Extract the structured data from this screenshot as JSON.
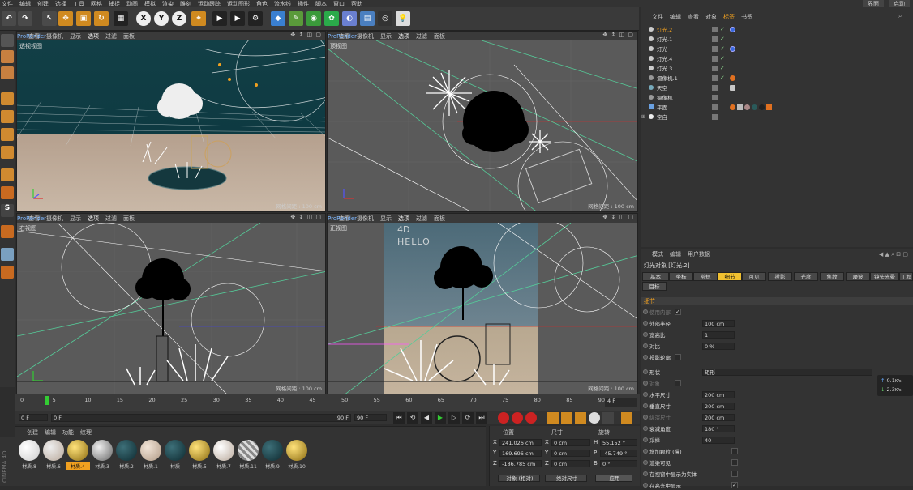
{
  "menubar": {
    "items": [
      "文件",
      "编辑",
      "创建",
      "选择",
      "工具",
      "网格",
      "捕捉",
      "动画",
      "模拟",
      "渲染",
      "雕刻",
      "运动跟踪",
      "运动图形",
      "角色",
      "流水线",
      "插件",
      "脚本",
      "窗口",
      "帮助"
    ],
    "right": [
      "界面",
      "启动"
    ]
  },
  "toolbar": {
    "x": "X",
    "y": "Y",
    "z": "Z"
  },
  "viewports": [
    {
      "menu": [
        "查看",
        "摄像机",
        "显示",
        "选项",
        "过滤",
        "面板",
        "ProRender"
      ],
      "title": "透视视图",
      "grid": "网格间距 : 100 cm"
    },
    {
      "menu": [
        "查看",
        "摄像机",
        "显示",
        "选项",
        "过滤",
        "面板",
        "ProRender"
      ],
      "title": "顶视图",
      "grid": "网格间距 : 100 cm"
    },
    {
      "menu": [
        "查看",
        "摄像机",
        "显示",
        "选项",
        "过滤",
        "面板",
        "ProRender"
      ],
      "title": "右视图",
      "grid": "网格间距 : 100 cm"
    },
    {
      "menu": [
        "查看",
        "摄像机",
        "显示",
        "选项",
        "过滤",
        "面板",
        "ProRender"
      ],
      "title": "正视图",
      "grid": "网格间距 : 100 cm"
    }
  ],
  "viewport_text": {
    "hello": "HELLO",
    "c4d": "4D"
  },
  "objmgr": {
    "menu": [
      "文件",
      "编辑",
      "查看",
      "对象",
      "标签",
      "书签"
    ],
    "rows": [
      "灯光.2",
      "灯光.1",
      "灯光",
      "灯光.4",
      "灯光.3",
      "摄像机.1",
      "天空",
      "摄像机",
      "平面",
      "空白"
    ]
  },
  "attr": {
    "menu": [
      "模式",
      "编辑",
      "用户数据"
    ],
    "title": "灯光对象 [灯光.2]",
    "tabs": [
      "基本",
      "坐标",
      "常规",
      "细节",
      "可见",
      "投影",
      "光度",
      "焦散",
      "噪波",
      "镜头光晕",
      "工程",
      "目标"
    ],
    "section": "细节",
    "props": [
      {
        "label": "使用内部",
        "value": "✓",
        "dim": true
      },
      {
        "label": "外部半径",
        "value": "100 cm"
      },
      {
        "label": "宽高比",
        "value": "1"
      },
      {
        "label": "对比",
        "value": "0 %"
      },
      {
        "label": "投影轮廓",
        "value": ""
      },
      {
        "label": "形状",
        "value": "矩形"
      },
      {
        "label": "对象",
        "value": "",
        "dim": true
      },
      {
        "label": "水平尺寸",
        "value": "200 cm"
      },
      {
        "label": "垂直尺寸",
        "value": "200 cm"
      },
      {
        "label": "纵深尺寸",
        "value": "200 cm",
        "dim": true
      },
      {
        "label": "衰减角度",
        "value": "180 °"
      },
      {
        "label": "采样",
        "value": "40"
      },
      {
        "label": "增加颗粒 (慢)",
        "value": ""
      },
      {
        "label": "渲染可见",
        "value": ""
      },
      {
        "label": "在视窗中显示为实体",
        "value": ""
      },
      {
        "label": "在高光中显示",
        "value": "✓"
      }
    ]
  },
  "timeline": {
    "ticks": [
      "0",
      "5",
      "10",
      "15",
      "20",
      "25",
      "30",
      "35",
      "40",
      "45",
      "50",
      "55",
      "60",
      "65",
      "70",
      "75",
      "80",
      "85",
      "90"
    ],
    "frame_right": "4 F"
  },
  "transport": {
    "start": "0 F",
    "mid_left": "0 F",
    "mid_right": "90 F",
    "end": "90 F"
  },
  "materials": {
    "menu": [
      "创建",
      "编辑",
      "功能",
      "纹理"
    ],
    "items": [
      "材质.8",
      "材质.6",
      "材质.4",
      "材质.3",
      "材质.2",
      "材质.1",
      "材质",
      "材质.5",
      "材质.7",
      "材质.11",
      "材质.9",
      "材质.10"
    ]
  },
  "coords": {
    "headers": [
      "位置",
      "尺寸",
      "旋转"
    ],
    "rows": [
      {
        "a": "X",
        "v": "241.026 cm",
        "b": "X",
        "s": "0 cm",
        "c": "H",
        "r": "55.152 °"
      },
      {
        "a": "Y",
        "v": "169.696 cm",
        "b": "Y",
        "s": "0 cm",
        "c": "P",
        "r": "-45.749 °"
      },
      {
        "a": "Z",
        "v": "-186.785 cm",
        "b": "Z",
        "s": "0 cm",
        "c": "B",
        "r": "0 °"
      }
    ],
    "dropdown1": "对象 (相对)",
    "dropdown2": "绝对尺寸",
    "apply": "应用"
  },
  "brand": "CINEMA 4D",
  "netmon": {
    "up": "0.1",
    "down": "2.3",
    "unit": "K/s"
  },
  "colors": {
    "accent": "#f0a020",
    "tab_active": "#f0c030",
    "prorender": "#7fb8ff"
  }
}
